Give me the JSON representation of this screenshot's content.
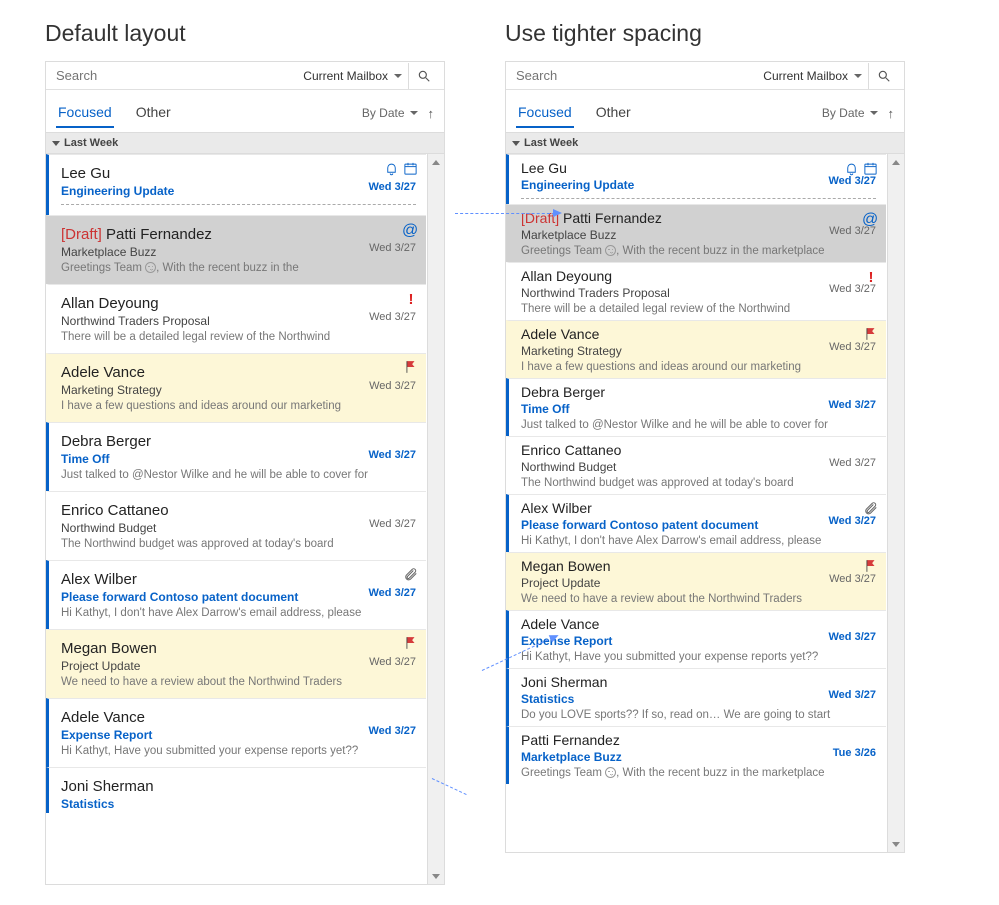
{
  "left_title": "Default layout",
  "right_title": "Use tighter spacing",
  "search": {
    "placeholder": "Search",
    "scope": "Current Mailbox"
  },
  "tabs": {
    "focused": "Focused",
    "other": "Other",
    "sort": "By Date"
  },
  "group": "Last Week",
  "messages_left": [
    {
      "from": "Lee Gu",
      "subject": "Engineering Update",
      "preview": "",
      "date": "Wed 3/27",
      "unread": true,
      "icons": [
        "bell",
        "cal"
      ],
      "dashed": true
    },
    {
      "from": "Patti Fernandez",
      "draft": "[Draft]",
      "subject": "Marketplace Buzz",
      "preview": "Greetings Team 😊,  With the recent buzz in the",
      "date": "Wed 3/27",
      "selected": true,
      "icons": [
        "at"
      ]
    },
    {
      "from": "Allan Deyoung",
      "subject": "Northwind Traders Proposal",
      "preview": "There will be a detailed legal review of the Northwind",
      "date": "Wed 3/27",
      "icons": [
        "bang"
      ]
    },
    {
      "from": "Adele Vance",
      "subject": "Marketing Strategy",
      "preview": "I have a few questions and ideas around our marketing",
      "date": "Wed 3/27",
      "flagged": true,
      "icons": [
        "flag"
      ]
    },
    {
      "from": "Debra Berger",
      "subject": "Time Off",
      "preview": "Just talked to @Nestor Wilke and he will be able to cover for",
      "date": "Wed 3/27",
      "unread": true
    },
    {
      "from": "Enrico Cattaneo",
      "subject": "Northwind Budget",
      "preview": "The Northwind budget was approved at today's board",
      "date": "Wed 3/27"
    },
    {
      "from": "Alex Wilber",
      "subject": "Please forward Contoso patent document",
      "preview": "Hi Kathyt,  I don't have Alex Darrow's email address, please",
      "date": "Wed 3/27",
      "unread": true,
      "icons": [
        "clip"
      ]
    },
    {
      "from": "Megan Bowen",
      "subject": "Project Update",
      "preview": "We need to have a review about the Northwind Traders",
      "date": "Wed 3/27",
      "flagged": true,
      "icons": [
        "flag"
      ]
    },
    {
      "from": "Adele Vance",
      "subject": "Expense Report",
      "preview": "Hi Kathyt,  Have you submitted your expense reports yet??",
      "date": "Wed 3/27",
      "unread": true
    },
    {
      "from": "Joni Sherman",
      "subject": "Statistics",
      "preview": "",
      "date": "",
      "unread": true,
      "truncated": true
    }
  ],
  "messages_right": [
    {
      "from": "Lee Gu",
      "subject": "Engineering Update",
      "preview": "",
      "date": "Wed 3/27",
      "unread": true,
      "icons": [
        "bell",
        "cal"
      ],
      "dashed": true
    },
    {
      "from": "Patti Fernandez",
      "draft": "[Draft]",
      "subject": "Marketplace Buzz",
      "preview": "Greetings Team 😊,  With the recent buzz in the marketplace",
      "date": "Wed 3/27",
      "selected": true,
      "icons": [
        "at"
      ]
    },
    {
      "from": "Allan Deyoung",
      "subject": "Northwind Traders Proposal",
      "preview": "There will be a detailed legal review of the Northwind",
      "date": "Wed 3/27",
      "icons": [
        "bang"
      ]
    },
    {
      "from": "Adele Vance",
      "subject": "Marketing Strategy",
      "preview": "I have a few questions and ideas around our marketing",
      "date": "Wed 3/27",
      "flagged": true,
      "icons": [
        "flag"
      ]
    },
    {
      "from": "Debra Berger",
      "subject": "Time Off",
      "preview": "Just talked to @Nestor Wilke and he will be able to cover for",
      "date": "Wed 3/27",
      "unread": true
    },
    {
      "from": "Enrico Cattaneo",
      "subject": "Northwind Budget",
      "preview": "The Northwind budget was approved at today's board",
      "date": "Wed 3/27"
    },
    {
      "from": "Alex Wilber",
      "subject": "Please forward Contoso patent document",
      "preview": "Hi Kathyt,  I don't have Alex Darrow's email address, please",
      "date": "Wed 3/27",
      "unread": true,
      "icons": [
        "clip"
      ]
    },
    {
      "from": "Megan Bowen",
      "subject": "Project Update",
      "preview": "We need to have a review about the Northwind Traders",
      "date": "Wed 3/27",
      "flagged": true,
      "icons": [
        "flag"
      ]
    },
    {
      "from": "Adele Vance",
      "subject": "Expense Report",
      "preview": "Hi Kathyt,  Have you submitted your expense reports yet??",
      "date": "Wed 3/27",
      "unread": true
    },
    {
      "from": "Joni Sherman",
      "subject": "Statistics",
      "preview": "Do you LOVE sports?? If so, read on…   We are going to start",
      "date": "Wed 3/27",
      "unread": true
    },
    {
      "from": "Patti Fernandez",
      "subject": "Marketplace Buzz",
      "preview": "Greetings Team 😊,  With the recent buzz in the marketplace",
      "date": "Tue 3/26",
      "unread": true
    }
  ]
}
